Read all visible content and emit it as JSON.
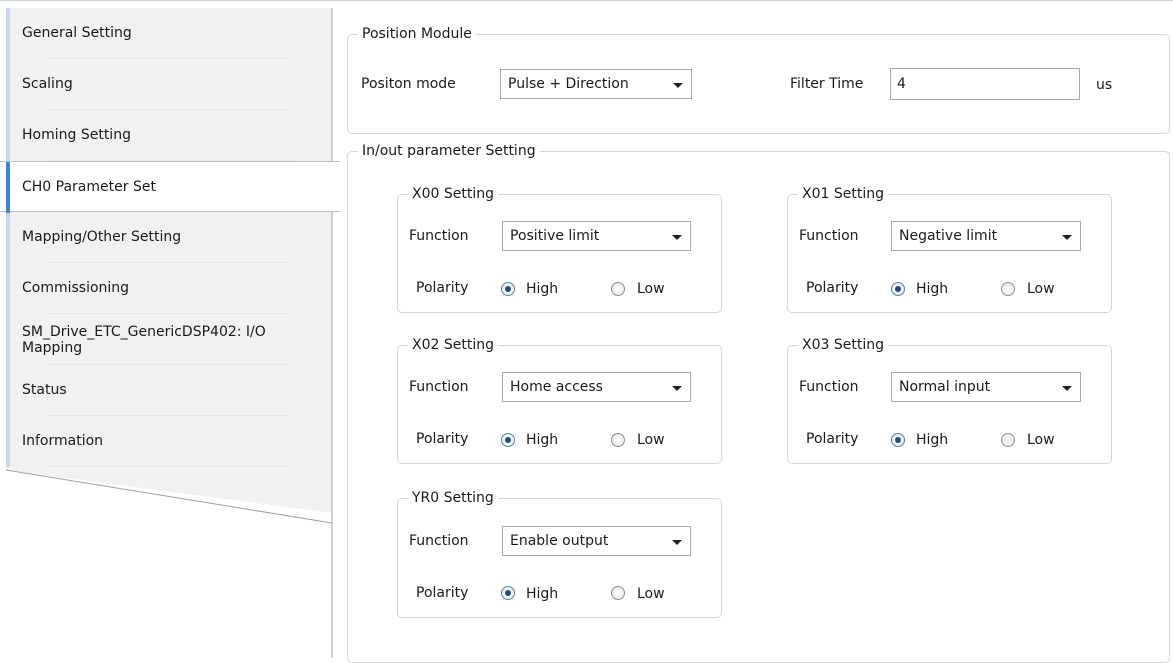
{
  "sidebar": {
    "items": [
      {
        "label": "General Setting"
      },
      {
        "label": "Scaling"
      },
      {
        "label": "Homing Setting"
      },
      {
        "label": "CH0 Parameter Set"
      },
      {
        "label": "Mapping/Other Setting"
      },
      {
        "label": "Commissioning"
      },
      {
        "label": "SM_Drive_ETC_GenericDSP402: I/O Mapping"
      },
      {
        "label": "Status"
      },
      {
        "label": "Information"
      }
    ],
    "selected": "CH0 Parameter Set"
  },
  "position_module": {
    "title": "Position Module",
    "mode_label": "Positon mode",
    "mode_value": "Pulse + Direction",
    "filter_label": "Filter Time",
    "filter_value": "4",
    "filter_unit": "us"
  },
  "inout": {
    "title": "In/out parameter Setting",
    "function_label": "Function",
    "polarity_label": "Polarity",
    "high_label": "High",
    "low_label": "Low",
    "groups": [
      {
        "title": "X00 Setting",
        "function": "Positive limit",
        "polarity": "High"
      },
      {
        "title": "X01 Setting",
        "function": "Negative limit",
        "polarity": "High"
      },
      {
        "title": "X02 Setting",
        "function": "Home access",
        "polarity": "High"
      },
      {
        "title": "X03 Setting",
        "function": "Normal input",
        "polarity": "High"
      },
      {
        "title": "YR0 Setting",
        "function": "Enable output",
        "polarity": "High"
      }
    ]
  }
}
